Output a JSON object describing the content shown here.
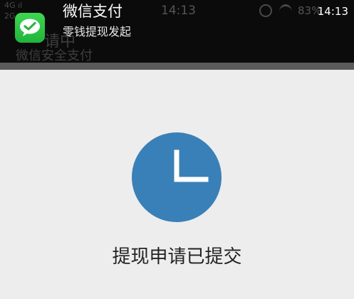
{
  "notification": {
    "app_name": "微信支付",
    "message": "零钱提现发起",
    "time": "14:13"
  },
  "background_status": {
    "carrier_1": "4G ıl",
    "carrier_2": "2G",
    "time": "14:13",
    "battery": "83%",
    "header_title": "请中",
    "header_subtitle": "微信安全支付"
  },
  "main": {
    "status_message": "提现申请已提交"
  },
  "colors": {
    "banner_bg": "#0b0b0b",
    "app_icon_green": "#2ac348",
    "clock_blue": "#3a80b8",
    "page_bg": "#ededed"
  },
  "icons": {
    "app": "wechat-icon",
    "status": "clock-icon"
  }
}
